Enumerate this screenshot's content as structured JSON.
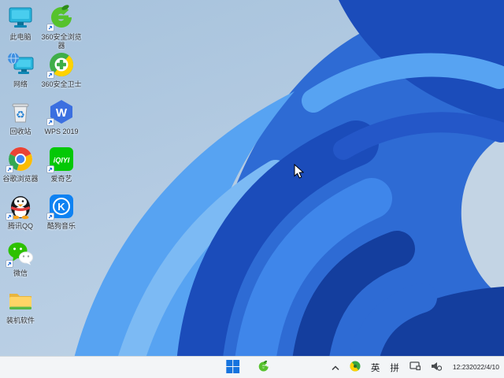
{
  "wallpaper": {
    "bg_top_left": "#a6c2dc",
    "bg_bottom": "#c3d6e8",
    "bloom_dark": "#143e9e",
    "bloom_mid": "#2e6bd4",
    "bloom_light": "#57a3f2"
  },
  "desktop": {
    "icons": [
      {
        "label": "此电脑",
        "name": "this-pc",
        "shortcut": false
      },
      {
        "label": "360安全浏览器",
        "name": "360-browser",
        "shortcut": true
      },
      {
        "label": "网络",
        "name": "network",
        "shortcut": false
      },
      {
        "label": "360安全卫士",
        "name": "360-safeguard",
        "shortcut": true
      },
      {
        "label": "回收站",
        "name": "recycle-bin",
        "shortcut": false
      },
      {
        "label": "WPS 2019",
        "name": "wps-2019",
        "shortcut": true
      },
      {
        "label": "谷歌浏览器",
        "name": "chrome",
        "shortcut": true
      },
      {
        "label": "爱奇艺",
        "name": "iqiyi",
        "shortcut": true
      },
      {
        "label": "腾讯QQ",
        "name": "tencent-qq",
        "shortcut": true
      },
      {
        "label": "酷狗音乐",
        "name": "kugou-music",
        "shortcut": true
      },
      {
        "label": "微信",
        "name": "wechat",
        "shortcut": true
      },
      {
        "label": "装机软件",
        "name": "software-folder",
        "shortcut": false
      }
    ]
  },
  "taskbar": {
    "tray": {
      "lang_indicator": "英",
      "ime_mode": "拼"
    },
    "clock": {
      "time": "12:23",
      "date": "2022/4/10"
    }
  }
}
